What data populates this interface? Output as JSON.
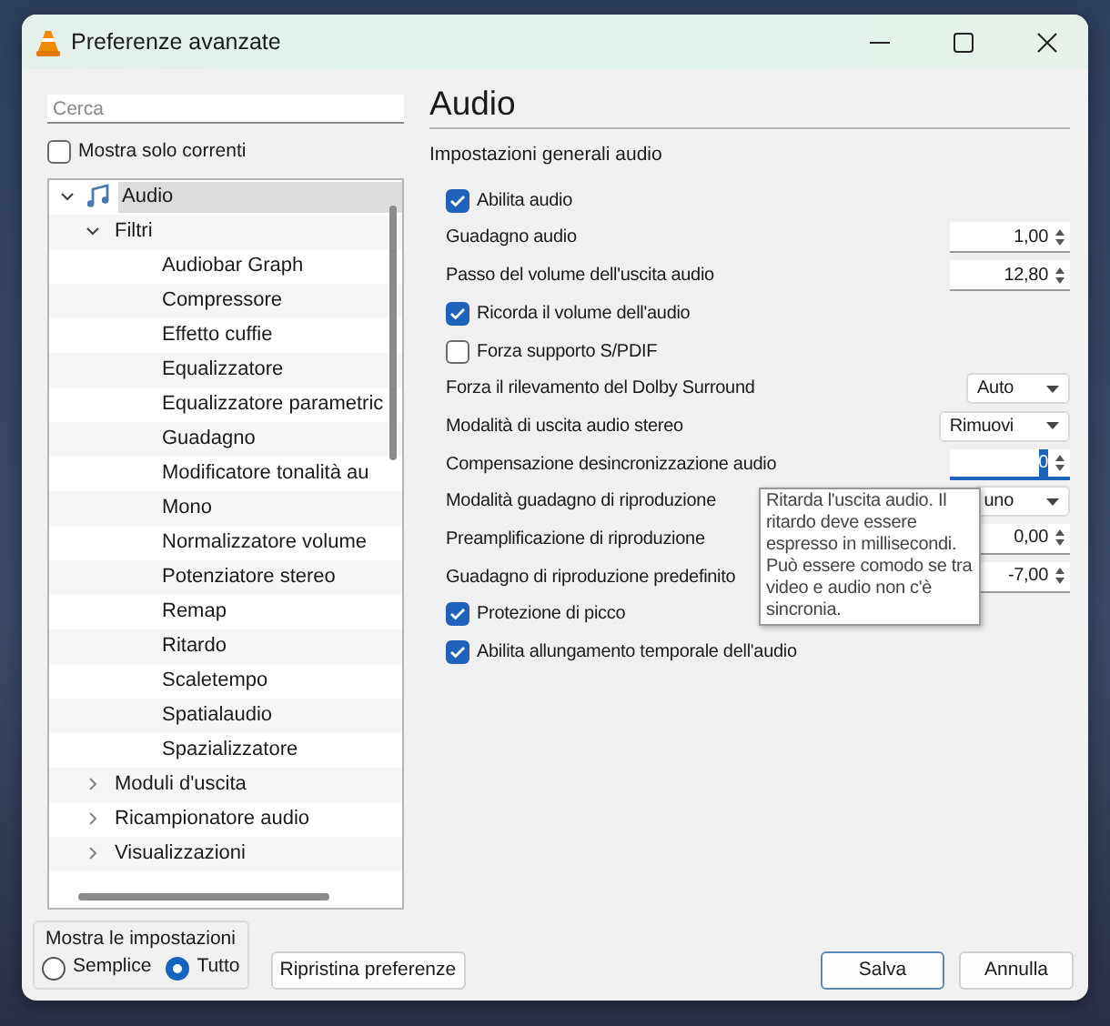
{
  "window": {
    "title": "Preferenze avanzate"
  },
  "search": {
    "placeholder": "Cerca"
  },
  "only_current": {
    "label": "Mostra solo correnti",
    "checked": false
  },
  "tree": [
    {
      "label": "Audio",
      "selected": true,
      "expanded": true,
      "children": [
        {
          "label": "Filtri",
          "selected": false,
          "expanded": true,
          "children": [
            {
              "label": "Audiobar Graph",
              "selected": false
            },
            {
              "label": "Compressore",
              "selected": false
            },
            {
              "label": "Effetto cuffie",
              "selected": false
            },
            {
              "label": "Equalizzatore",
              "selected": false
            },
            {
              "label": "Equalizzatore parametric",
              "selected": false
            },
            {
              "label": "Guadagno",
              "selected": false
            },
            {
              "label": "Modificatore tonalità au",
              "selected": false
            },
            {
              "label": "Mono",
              "selected": false
            },
            {
              "label": "Normalizzatore volume",
              "selected": false
            },
            {
              "label": "Potenziatore stereo",
              "selected": false
            },
            {
              "label": "Remap",
              "selected": false
            },
            {
              "label": "Ritardo",
              "selected": false
            },
            {
              "label": "Scaletempo",
              "selected": false
            },
            {
              "label": "Spatialaudio",
              "selected": false
            },
            {
              "label": "Spazializzatore",
              "selected": false
            }
          ]
        },
        {
          "label": "Moduli d'uscita",
          "selected": false,
          "expanded": false
        },
        {
          "label": "Ricampionatore audio",
          "selected": false,
          "expanded": false
        },
        {
          "label": "Visualizzazioni",
          "selected": false,
          "expanded": false
        }
      ]
    }
  ],
  "show_settings": {
    "title": "Mostra le impostazioni",
    "options": [
      {
        "label": "Semplice",
        "selected": false
      },
      {
        "label": "Tutto",
        "selected": true
      }
    ]
  },
  "reset_button": "Ripristina preferenze",
  "panel": {
    "heading": "Audio",
    "subtitle": "Impostazioni generali audio",
    "settings": [
      {
        "kind": "checkbox",
        "label": "Abilita audio",
        "checked": true
      },
      {
        "kind": "spin",
        "label": "Guadagno audio",
        "value": "1,00",
        "focused": false
      },
      {
        "kind": "spin",
        "label": "Passo del volume dell'uscita audio",
        "value": "12,80",
        "focused": false
      },
      {
        "kind": "checkbox",
        "label": "Ricorda il volume dell'audio",
        "checked": true
      },
      {
        "kind": "checkbox",
        "label": "Forza supporto S/PDIF",
        "checked": false
      },
      {
        "kind": "select",
        "label": "Forza il rilevamento del Dolby Surround",
        "value": "Auto"
      },
      {
        "kind": "select",
        "label": "Modalità di uscita audio stereo",
        "value": "Rimuovi"
      },
      {
        "kind": "spin",
        "label": "Compensazione desincronizzazione audio",
        "value": "0",
        "focused": true
      },
      {
        "kind": "select",
        "label": "Modalità guadagno di riproduzione",
        "value": "uno"
      },
      {
        "kind": "spin",
        "label": "Preamplificazione di riproduzione",
        "value": "0,00",
        "focused": false
      },
      {
        "kind": "spin",
        "label": "Guadagno di riproduzione predefinito",
        "value": "-7,00",
        "focused": false
      },
      {
        "kind": "checkbox",
        "label": "Protezione di picco",
        "checked": true
      },
      {
        "kind": "checkbox",
        "label": "Abilita allungamento temporale dell'audio",
        "checked": true
      }
    ],
    "tooltip": "Ritarda l'uscita audio. Il ritardo deve essere espresso in millisecondi. Può essere comodo se tra video e audio non c'è sincronia."
  },
  "buttons": [
    {
      "label": "Salva",
      "default": true
    },
    {
      "label": "Annulla",
      "default": false
    }
  ]
}
